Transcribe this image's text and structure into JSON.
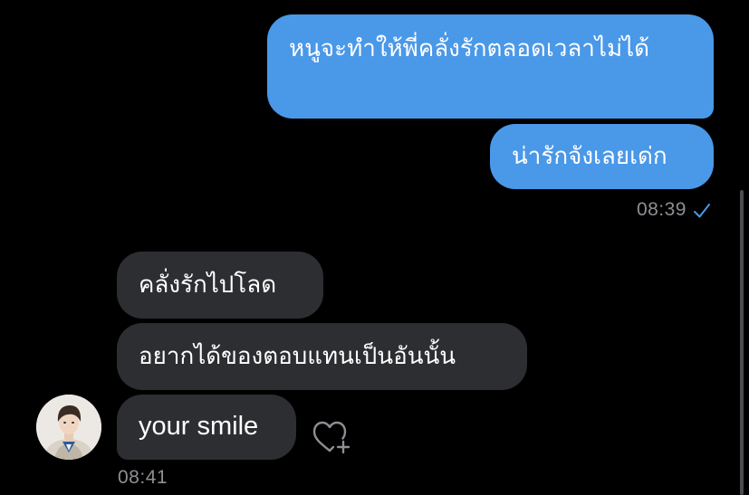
{
  "messages": {
    "outgoing": [
      {
        "text": "หนูจะทำให้พี่คลั่งรักตลอดเวลาไม่ได้"
      },
      {
        "text": "น่ารักจังเลยเด่ก"
      }
    ],
    "outgoing_time": "08:39",
    "incoming": [
      {
        "text": "คลั่งรักไปโลด"
      },
      {
        "text": "อยากได้ของตอบแทนเป็นอันนั้น"
      },
      {
        "text": "your smile"
      }
    ],
    "incoming_time": "08:41"
  },
  "colors": {
    "background": "#000000",
    "outgoing_bubble": "#4a98e8",
    "incoming_bubble": "#2d2e31",
    "meta_text": "#8c8f94",
    "read_check": "#4a98e8"
  },
  "icons": {
    "read_receipt": "checkmark-icon",
    "reaction": "heart-plus-icon",
    "avatar": "avatar"
  }
}
